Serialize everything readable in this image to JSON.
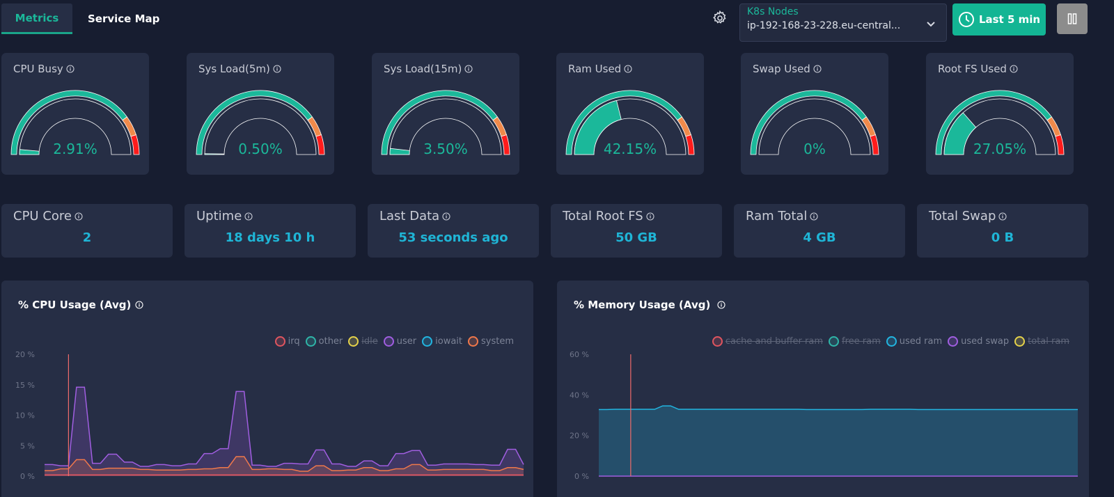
{
  "tabs": [
    {
      "label": "Metrics",
      "active": true
    },
    {
      "label": "Service Map",
      "active": false
    }
  ],
  "toolbar": {
    "settings_icon": "gear-icon",
    "node_select": {
      "label": "K8s Nodes",
      "value": "ip-192-168-23-228.eu-central..."
    },
    "time_range_label": "Last 5 min",
    "pause_icon": "pause-icon"
  },
  "colors": {
    "accent": "#1bb89a",
    "warn": "#f08a4b",
    "danger": "#ff1b1b",
    "stat_value": "#1fb5d6"
  },
  "gauges": [
    {
      "title": "CPU Busy",
      "value_text": "2.91%",
      "value": 2.91
    },
    {
      "title": "Sys Load(5m)",
      "value_text": "0.50%",
      "value": 0.5
    },
    {
      "title": "Sys Load(15m)",
      "value_text": "3.50%",
      "value": 3.5
    },
    {
      "title": "Ram Used",
      "value_text": "42.15%",
      "value": 42.15
    },
    {
      "title": "Swap Used",
      "value_text": "0%",
      "value": 0
    },
    {
      "title": "Root FS Used",
      "value_text": "27.05%",
      "value": 27.05
    }
  ],
  "gauge_thresholds": {
    "warn": 80,
    "danger": 90,
    "max": 100
  },
  "stats": [
    {
      "title": "CPU Core",
      "value": "2"
    },
    {
      "title": "Uptime",
      "value": "18 days 10 h"
    },
    {
      "title": "Last Data",
      "value": "53 seconds ago"
    },
    {
      "title": "Total Root FS",
      "value": "50 GB"
    },
    {
      "title": "Ram Total",
      "value": "4 GB"
    },
    {
      "title": "Total Swap",
      "value": "0 B"
    }
  ],
  "chart_data": [
    {
      "type": "area",
      "title": "% CPU Usage (Avg)",
      "ylim": [
        0,
        20
      ],
      "yticks": [
        "0 %",
        "5 %",
        "10 %",
        "15 %",
        "20 %"
      ],
      "ytick_values": [
        0,
        5,
        10,
        15,
        20
      ],
      "legend": [
        {
          "name": "irq",
          "color": "#e0555f",
          "hidden": false
        },
        {
          "name": "other",
          "color": "#2fb5a8",
          "hidden": false
        },
        {
          "name": "idle",
          "color": "#e5d24a",
          "hidden": true
        },
        {
          "name": "user",
          "color": "#a05ee0",
          "hidden": false
        },
        {
          "name": "iowait",
          "color": "#22b5e0",
          "hidden": false
        },
        {
          "name": "system",
          "color": "#f0784b",
          "hidden": false
        }
      ],
      "cursor_index": 3,
      "series": [
        {
          "name": "user",
          "color": "#a05ee0",
          "values": [
            1.9,
            1.9,
            1.7,
            1.7,
            14.6,
            14.6,
            2.1,
            2.1,
            3.6,
            3.6,
            2.3,
            2.3,
            1.6,
            1.6,
            1.9,
            1.9,
            1.7,
            1.7,
            2.0,
            2.0,
            3.7,
            3.7,
            4.5,
            4.5,
            13.9,
            13.9,
            1.8,
            1.8,
            1.6,
            1.6,
            2.1,
            2.1,
            2.0,
            2.0,
            4.3,
            4.3,
            2.0,
            2.0,
            1.6,
            1.6,
            2.5,
            2.5,
            1.7,
            1.7,
            3.7,
            3.7,
            4.2,
            4.2,
            1.8,
            1.8,
            2.0,
            2.0,
            2.0,
            2.0,
            1.9,
            1.9,
            1.8,
            1.8,
            4.4,
            4.4,
            1.9
          ]
        },
        {
          "name": "system",
          "color": "#f0784b",
          "values": [
            0.9,
            0.9,
            1.2,
            1.2,
            2.7,
            2.7,
            1.1,
            1.1,
            1.3,
            1.3,
            1.3,
            1.3,
            1.1,
            1.1,
            1.0,
            1.0,
            1.0,
            1.0,
            1.1,
            1.1,
            1.2,
            1.2,
            1.4,
            1.4,
            3.2,
            3.2,
            1.1,
            1.1,
            1.2,
            1.2,
            1.1,
            1.1,
            0.8,
            0.8,
            1.7,
            1.7,
            0.9,
            0.9,
            1.0,
            1.0,
            1.4,
            1.4,
            0.9,
            0.9,
            1.2,
            1.2,
            1.9,
            1.9,
            1.0,
            1.0,
            1.1,
            1.1,
            1.1,
            1.1,
            1.1,
            1.1,
            0.9,
            0.9,
            1.4,
            1.4,
            1.1
          ]
        },
        {
          "name": "irq",
          "color": "#e0555f",
          "values": [
            0.2,
            0.2,
            0.2,
            0.2,
            0.2,
            0.2,
            0.2,
            0.2,
            0.2,
            0.2,
            0.2,
            0.2,
            0.2,
            0.2,
            0.2,
            0.2,
            0.2,
            0.2,
            0.2,
            0.2,
            0.2,
            0.2,
            0.2,
            0.2,
            0.2,
            0.2,
            0.2,
            0.2,
            0.2,
            0.2,
            0.2,
            0.2,
            0.2,
            0.2,
            0.2,
            0.2,
            0.2,
            0.2,
            0.2,
            0.2,
            0.2,
            0.2,
            0.2,
            0.2,
            0.2,
            0.2,
            0.2,
            0.2,
            0.2,
            0.2,
            0.2,
            0.2,
            0.2,
            0.2,
            0.2,
            0.2,
            0.2,
            0.2,
            0.2,
            0.2,
            0.2
          ]
        }
      ]
    },
    {
      "type": "area",
      "title": "% Memory Usage (Avg)",
      "ylim": [
        0,
        60
      ],
      "yticks": [
        "0 %",
        "20 %",
        "40 %",
        "60 %"
      ],
      "ytick_values": [
        0,
        20,
        40,
        60
      ],
      "legend": [
        {
          "name": "cache and buffer ram",
          "color": "#e0555f",
          "hidden": true
        },
        {
          "name": "free ram",
          "color": "#2fb5a8",
          "hidden": true
        },
        {
          "name": "used ram",
          "color": "#22b5e0",
          "hidden": false
        },
        {
          "name": "used swap",
          "color": "#a05ee0",
          "hidden": false
        },
        {
          "name": "total ram",
          "color": "#e5d24a",
          "hidden": true
        }
      ],
      "cursor_index": 4,
      "series": [
        {
          "name": "used ram",
          "color": "#22b5e0",
          "values": [
            32.8,
            32.8,
            32.9,
            32.9,
            32.9,
            32.9,
            32.9,
            32.9,
            34.6,
            34.6,
            32.9,
            32.9,
            32.9,
            32.9,
            32.9,
            32.9,
            32.9,
            32.9,
            32.9,
            32.9,
            32.9,
            32.9,
            32.9,
            32.9,
            32.9,
            32.9,
            32.8,
            32.8,
            32.8,
            32.8,
            32.8,
            32.8,
            32.8,
            32.8,
            32.9,
            32.9,
            32.9,
            32.9,
            32.9,
            32.9,
            32.8,
            32.8,
            32.8,
            32.8,
            32.8,
            32.8,
            32.8,
            32.8,
            32.8,
            32.8,
            32.8,
            32.8,
            32.8,
            32.8,
            32.8,
            32.8,
            32.8,
            32.8,
            32.8,
            32.8,
            32.8
          ]
        },
        {
          "name": "used swap",
          "color": "#a05ee0",
          "values": [
            0,
            0,
            0,
            0,
            0,
            0,
            0,
            0,
            0,
            0,
            0,
            0,
            0,
            0,
            0,
            0,
            0,
            0,
            0,
            0,
            0,
            0,
            0,
            0,
            0,
            0,
            0,
            0,
            0,
            0,
            0,
            0,
            0,
            0,
            0,
            0,
            0,
            0,
            0,
            0,
            0,
            0,
            0,
            0,
            0,
            0,
            0,
            0,
            0,
            0,
            0,
            0,
            0,
            0,
            0,
            0,
            0,
            0,
            0,
            0,
            0
          ]
        }
      ]
    }
  ]
}
